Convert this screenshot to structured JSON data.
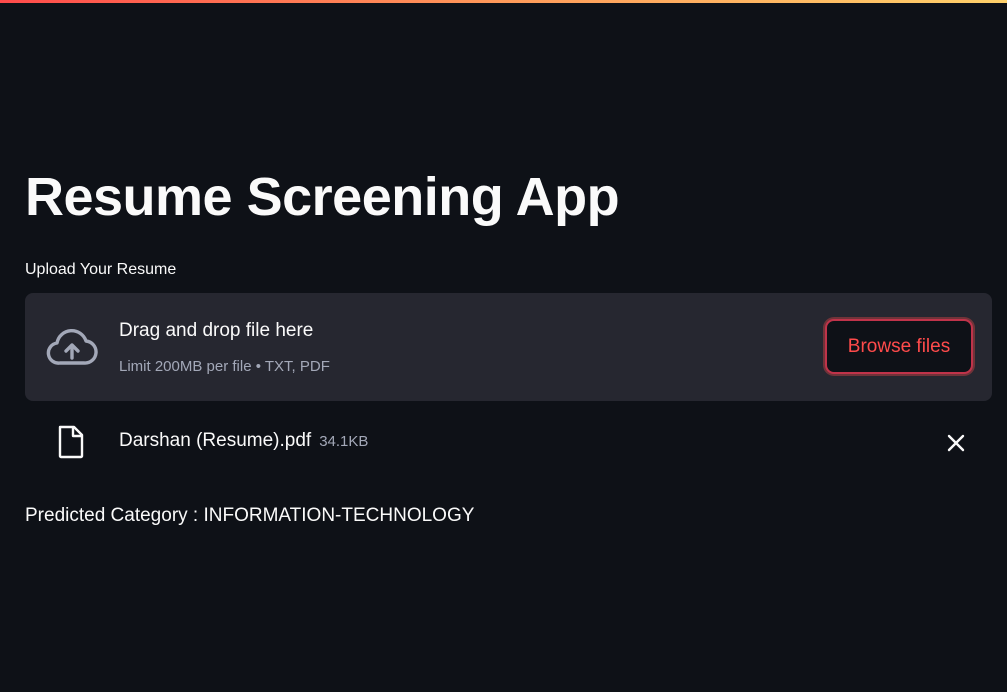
{
  "app": {
    "title": "Resume Screening App"
  },
  "uploader": {
    "label": "Upload Your Resume",
    "dropzone_title": "Drag and drop file here",
    "dropzone_subtitle": "Limit 200MB per file • TXT, PDF",
    "browse_label": "Browse files",
    "icon": "cloud-upload-icon"
  },
  "uploaded_file": {
    "name": "Darshan (Resume).pdf",
    "size": "34.1KB",
    "icon": "file-icon",
    "remove_icon": "close-icon"
  },
  "result": {
    "text": "Predicted Category : INFORMATION-TECHNOLOGY"
  },
  "colors": {
    "background": "#0e1117",
    "panel": "#262730",
    "accent": "#ff4b4b",
    "text": "#fafafa",
    "muted_text": "#a3a8b8"
  }
}
